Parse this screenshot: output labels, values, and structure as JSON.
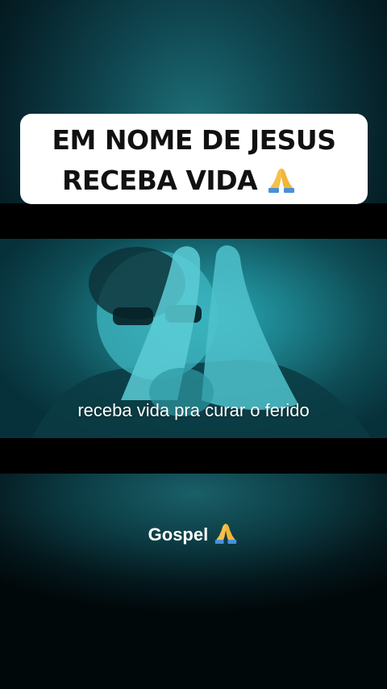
{
  "overlay": {
    "title_line_1": "EM NOME DE JESUS",
    "title_line_2": "RECEBA VIDA",
    "title_emoji": "praying-hands-icon"
  },
  "video": {
    "caption": "receba vida pra curar o ferido"
  },
  "footer": {
    "label": "Gospel",
    "emoji": "praying-hands-icon"
  },
  "colors": {
    "teal": "#1b7d88",
    "title_bg": "#ffffff",
    "emoji_blue": "#4a90d9"
  }
}
